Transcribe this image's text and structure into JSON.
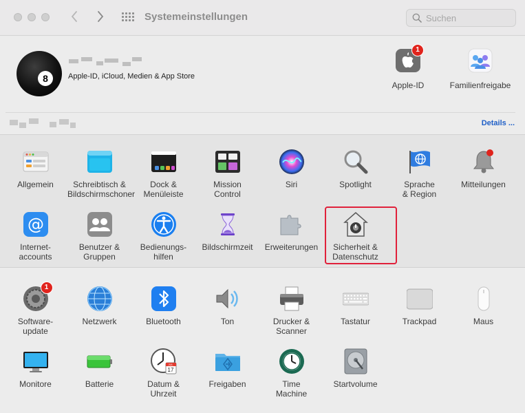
{
  "window": {
    "title": "Systemeinstellungen",
    "back_icon": "chevron-left-icon",
    "forward_icon": "chevron-right-icon",
    "grid_icon": "grid-icon"
  },
  "search": {
    "placeholder": "Suchen",
    "value": ""
  },
  "account": {
    "subtitle": "Apple-ID, iCloud, Medien & App Store",
    "avatar_text": "8",
    "apple_id": {
      "label": "Apple-ID",
      "badge": "1"
    },
    "family": {
      "label": "Familienfreigabe"
    },
    "details_link": "Details ..."
  },
  "section1": [
    {
      "label": "Allgemein"
    },
    {
      "label": "Schreibtisch &\nBildschirmschoner"
    },
    {
      "label": "Dock &\nMenüleiste"
    },
    {
      "label": "Mission\nControl"
    },
    {
      "label": "Siri"
    },
    {
      "label": "Spotlight"
    },
    {
      "label": "Sprache\n& Region"
    },
    {
      "label": "Mitteilungen"
    },
    {
      "label": "Internet-\naccounts"
    },
    {
      "label": "Benutzer &\nGruppen"
    },
    {
      "label": "Bedienungs-\nhilfen"
    },
    {
      "label": "Bildschirmzeit"
    },
    {
      "label": "Erweiterungen"
    },
    {
      "label": "Sicherheit &\nDatenschutz"
    }
  ],
  "section2": [
    {
      "label": "Software-\nupdate",
      "badge": "1"
    },
    {
      "label": "Netzwerk"
    },
    {
      "label": "Bluetooth"
    },
    {
      "label": "Ton"
    },
    {
      "label": "Drucker &\nScanner"
    },
    {
      "label": "Tastatur"
    },
    {
      "label": "Trackpad"
    },
    {
      "label": "Maus"
    },
    {
      "label": "Monitore"
    },
    {
      "label": "Batterie"
    },
    {
      "label": "Datum &\nUhrzeit",
      "calendar_month": "JUL",
      "calendar_day": "17"
    },
    {
      "label": "Freigaben"
    },
    {
      "label": "Time\nMachine"
    },
    {
      "label": "Startvolume"
    }
  ]
}
